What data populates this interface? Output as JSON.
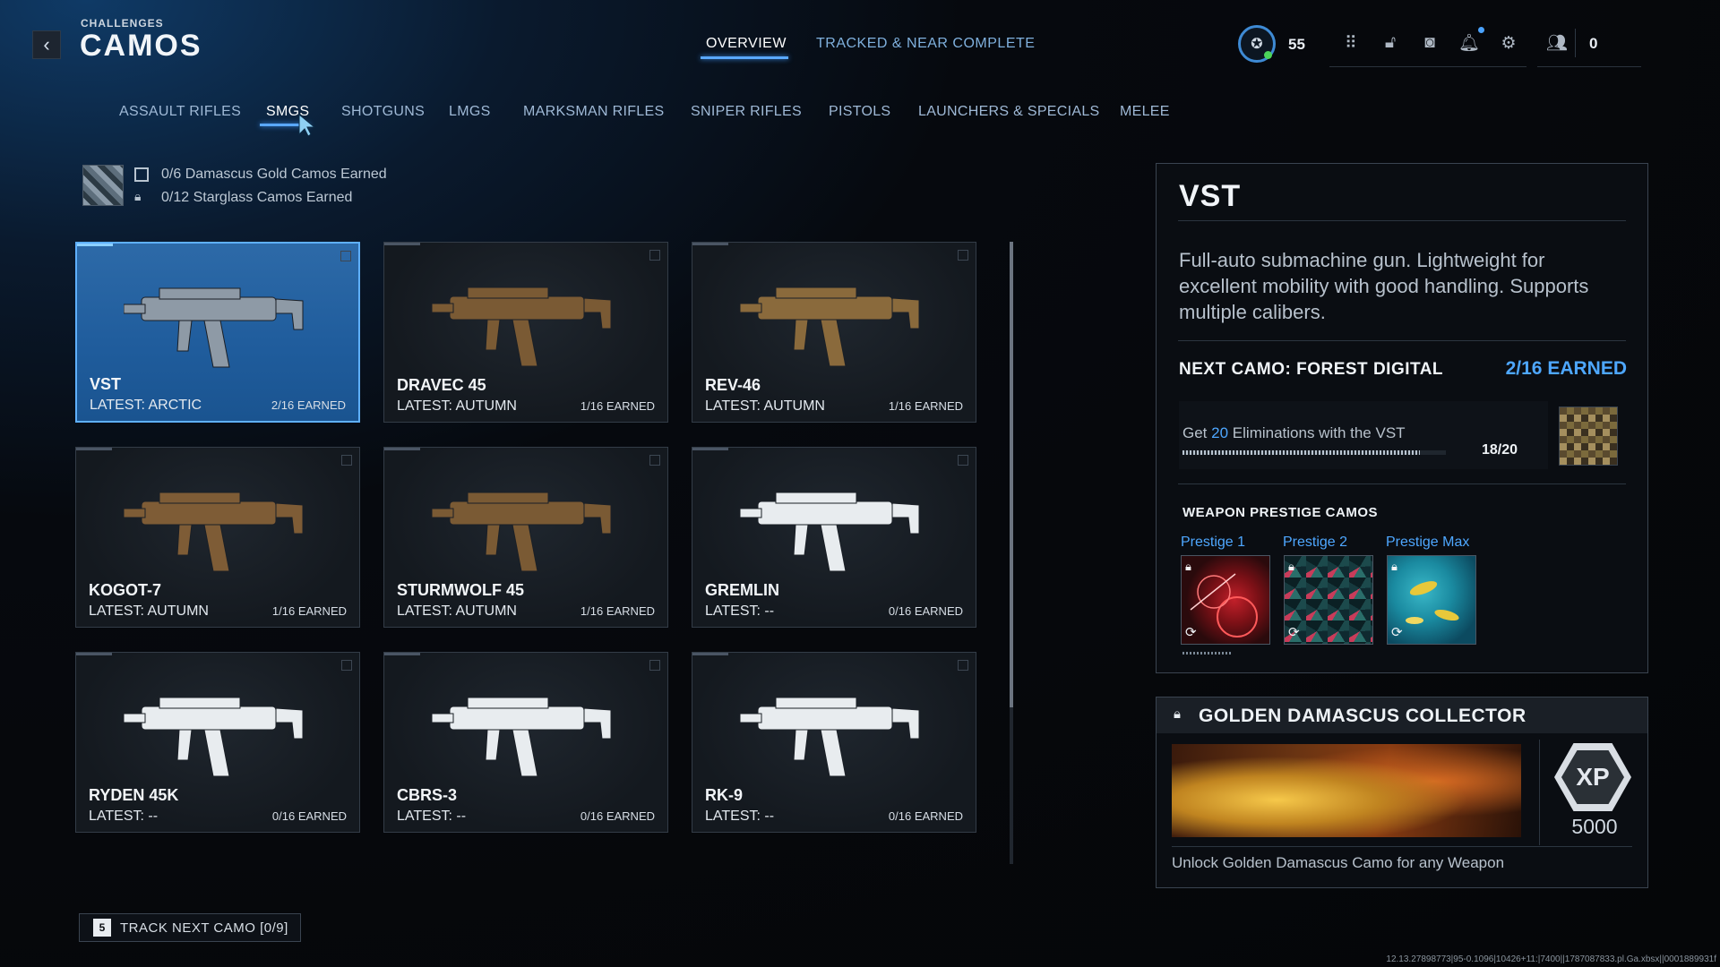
{
  "header": {
    "breadcrumb": "CHALLENGES",
    "title": "CAMOS",
    "tabs": [
      {
        "label": "OVERVIEW"
      },
      {
        "label": "TRACKED & NEAR COMPLETE"
      }
    ],
    "player_level": "55",
    "currency_count": "0"
  },
  "categories": [
    {
      "label": "ASSAULT RIFLES"
    },
    {
      "label": "SMGS"
    },
    {
      "label": "SHOTGUNS"
    },
    {
      "label": "LMGS"
    },
    {
      "label": "MARKSMAN RIFLES"
    },
    {
      "label": "SNIPER RIFLES"
    },
    {
      "label": "PISTOLS"
    },
    {
      "label": "LAUNCHERS & SPECIALS"
    },
    {
      "label": "MELEE"
    }
  ],
  "summary": {
    "damascus": "0/6 Damascus Gold Camos Earned",
    "starglass": "0/12 Starglass Camos Earned"
  },
  "weapons": [
    {
      "name": "VST",
      "latest": "LATEST: ARCTIC",
      "earned": "2/16 EARNED",
      "gun_color": "#8e9aa6"
    },
    {
      "name": "DRAVEC 45",
      "latest": "LATEST: AUTUMN",
      "earned": "1/16 EARNED",
      "gun_color": "#7a5a34"
    },
    {
      "name": "REV-46",
      "latest": "LATEST: AUTUMN",
      "earned": "1/16 EARNED",
      "gun_color": "#8a6a3c"
    },
    {
      "name": "KOGOT-7",
      "latest": "LATEST: AUTUMN",
      "earned": "1/16 EARNED",
      "gun_color": "#7e5c36"
    },
    {
      "name": "STURMWOLF 45",
      "latest": "LATEST: AUTUMN",
      "earned": "1/16 EARNED",
      "gun_color": "#7a5a34"
    },
    {
      "name": "GREMLIN",
      "latest": "LATEST: --",
      "earned": "0/16 EARNED",
      "gun_color": "#e8ecef"
    },
    {
      "name": "RYDEN 45K",
      "latest": "LATEST: --",
      "earned": "0/16 EARNED",
      "gun_color": "#e8ecef"
    },
    {
      "name": "CBRS-3",
      "latest": "LATEST: --",
      "earned": "0/16 EARNED",
      "gun_color": "#e8ecef"
    },
    {
      "name": "RK-9",
      "latest": "LATEST: --",
      "earned": "0/16 EARNED",
      "gun_color": "#e8ecef"
    }
  ],
  "detail": {
    "name": "VST",
    "description": "Full-auto submachine gun. Lightweight for excellent mobility with good handling. Supports multiple calibers.",
    "next_camo": "NEXT CAMO: FOREST DIGITAL",
    "earned": "2/16 EARNED",
    "challenge_prefix": "Get",
    "challenge_num": "20",
    "challenge_suffix": "Eliminations with the VST",
    "progress_text": "18/20",
    "progress_fraction": 0.9,
    "prestige_title": "WEAPON PRESTIGE CAMOS",
    "prestige": [
      {
        "label": "Prestige 1"
      },
      {
        "label": "Prestige 2"
      },
      {
        "label": "Prestige Max"
      }
    ]
  },
  "reward": {
    "title": "GOLDEN DAMASCUS COLLECTOR",
    "xp_label": "XP",
    "xp_value": "5000",
    "description": "Unlock Golden Damascus Camo for any Weapon"
  },
  "footer": {
    "track_key": "5",
    "track_label": "TRACK NEXT CAMO [0/9]",
    "build_info": "12.13.27898773|95-0.1096|10426+11:|7400||1787087833.pl.Ga.xbsx||0001889931f"
  },
  "colors": {
    "accent": "#4ea7ff",
    "selected_card": "#1f5c9c"
  }
}
